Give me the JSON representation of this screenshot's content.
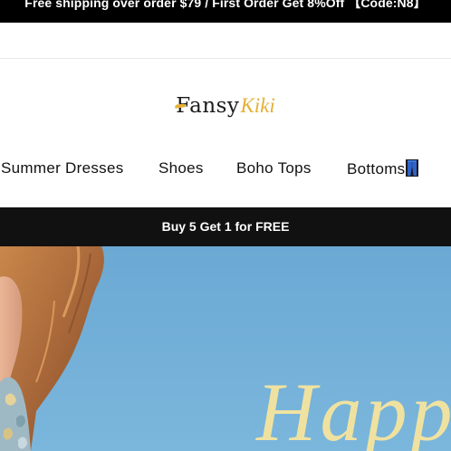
{
  "announcement": {
    "text": "Free shipping over order $79 / First Order Get 8%Off 【Code:N8】"
  },
  "logo": {
    "word_main": "Fansy",
    "word_script": "Kiki"
  },
  "nav": {
    "items": [
      {
        "label": "Summer Dresses"
      },
      {
        "label": "Shoes"
      },
      {
        "label": "Boho Tops"
      },
      {
        "label": "Bottoms",
        "icon": "jeans-icon"
      }
    ]
  },
  "promo": {
    "text": "Buy 5 Get 1 for FREE"
  },
  "hero": {
    "headline": "Happ",
    "icon": "hero-banner-image"
  },
  "colors": {
    "announcement_bg": "#000000",
    "promo_bg": "#111111",
    "brand_gold": "#e4b036",
    "sky": "#6aaad6",
    "hero_script": "#efe2a0"
  }
}
